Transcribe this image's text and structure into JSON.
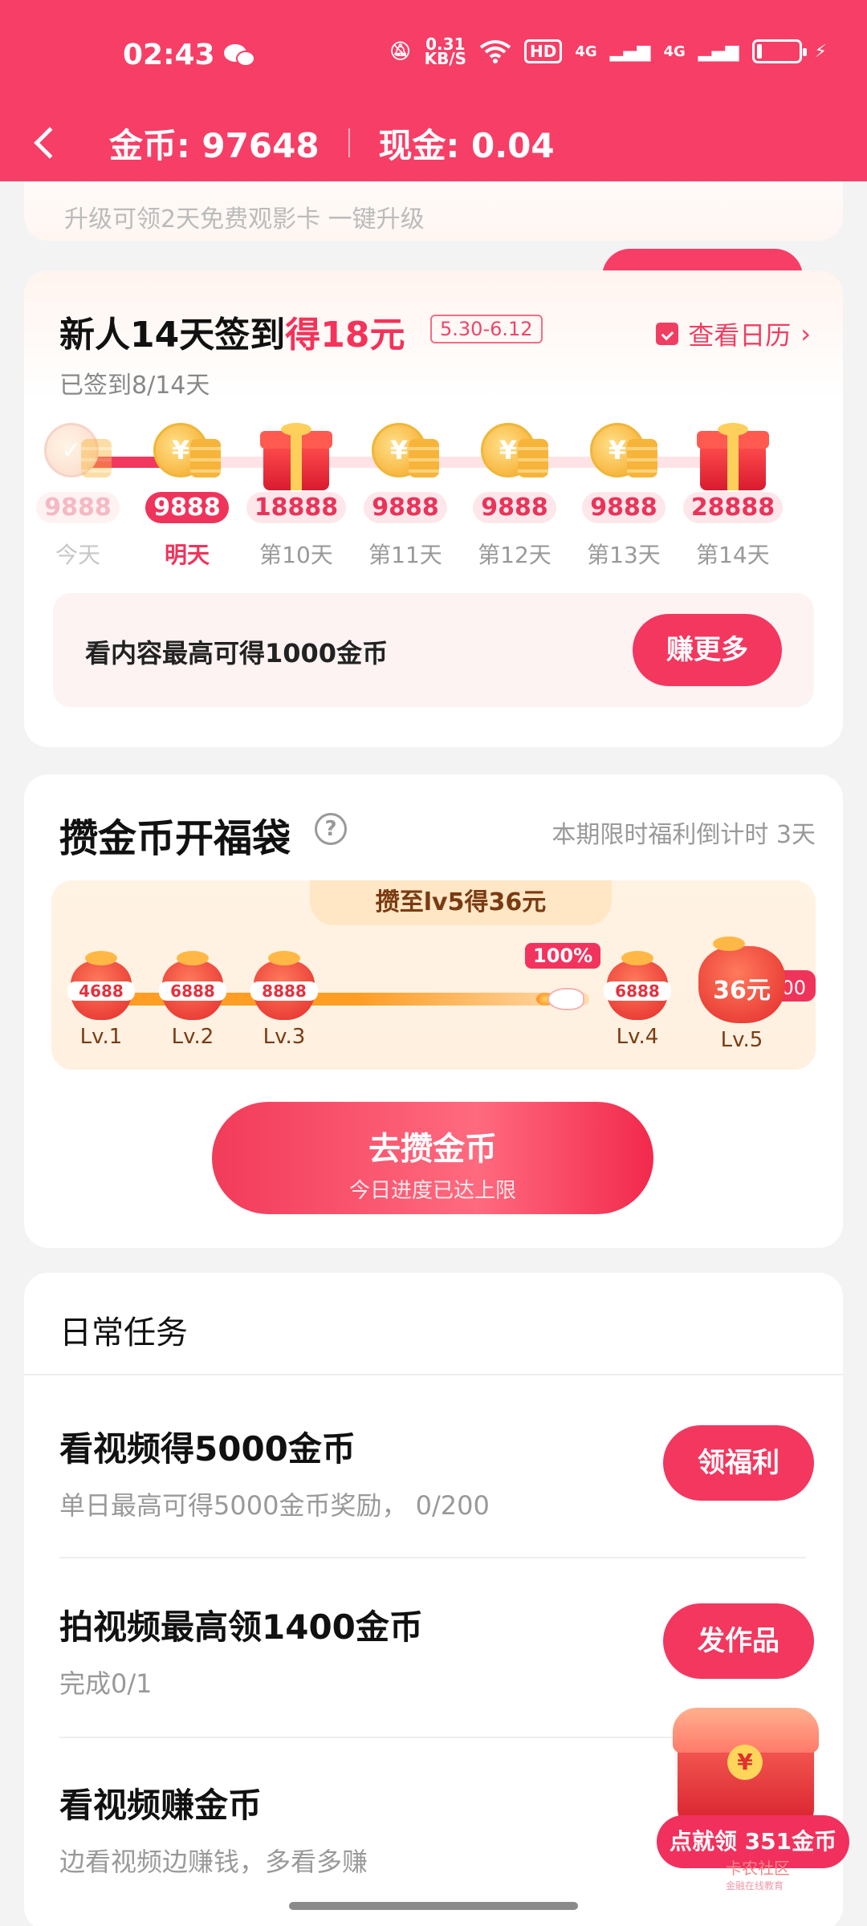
{
  "status_bar": {
    "time": "02:43",
    "net_speed_value": "0.31",
    "net_speed_unit": "KB/S",
    "hd_label": "HD",
    "sig1": "4G",
    "sig2": "4G"
  },
  "header": {
    "coins_label": "金币: 97648",
    "cash_label": "现金: 0.04"
  },
  "previous_card": {
    "text": "升级可领2天免费观影卡  一键升级"
  },
  "signin": {
    "title_prefix": "新人14天签到",
    "title_highlight": "得18元",
    "date_badge": "5.30-6.12",
    "calendar_link": "查看日历",
    "progress_text": "已签到8/14天",
    "days": [
      {
        "amount": "9888",
        "label": "今天",
        "icon": "coin-icon",
        "state": "done"
      },
      {
        "amount": "9888",
        "label": "明天",
        "icon": "coin-icon",
        "state": "highlight"
      },
      {
        "amount": "18888",
        "label": "第10天",
        "icon": "gift-icon",
        "state": "normal"
      },
      {
        "amount": "9888",
        "label": "第11天",
        "icon": "coin-icon",
        "state": "normal"
      },
      {
        "amount": "9888",
        "label": "第12天",
        "icon": "coin-icon",
        "state": "normal"
      },
      {
        "amount": "9888",
        "label": "第13天",
        "icon": "coin-icon",
        "state": "normal"
      },
      {
        "amount": "28888",
        "label": "第14天",
        "icon": "gift-icon",
        "state": "normal"
      }
    ],
    "earn_text": "看内容最高可得1000金币",
    "earn_button": "赚更多"
  },
  "lucky_bag": {
    "title": "攒金币开福袋",
    "countdown": "本期限时福利倒计时 3天",
    "tab_text": "攒至lv5得36元",
    "progress_badge": "100%",
    "grab_badge": "已抢0/200",
    "levels": [
      {
        "value": "4688",
        "level": "Lv.1"
      },
      {
        "value": "6888",
        "level": "Lv.2"
      },
      {
        "value": "8888",
        "level": "Lv.3"
      },
      {
        "value": "6888",
        "level": "Lv.4"
      },
      {
        "value": "36元",
        "level": "Lv.5"
      }
    ],
    "action_button": "去攒金币",
    "action_sub": "今日进度已达上限"
  },
  "daily_tasks": {
    "title": "日常任务",
    "tasks": [
      {
        "name": "看视频得5000金币",
        "desc": "单日最高可得5000金币奖励， 0/200",
        "button": "领福利"
      },
      {
        "name": "拍视频最高领1400金币",
        "desc": "完成0/1",
        "button": "发作品"
      },
      {
        "name": "看视频赚金币",
        "desc": "边看视频边赚钱，多看多赚",
        "button": ""
      }
    ]
  },
  "floating_widget": {
    "label": "点就领 351金币"
  },
  "watermark": {
    "title": "卡农社区",
    "subtitle": "金融在线教育"
  },
  "colors": {
    "brand": "#f73e66",
    "accent": "#f3375f",
    "gold": "#f5a623"
  }
}
